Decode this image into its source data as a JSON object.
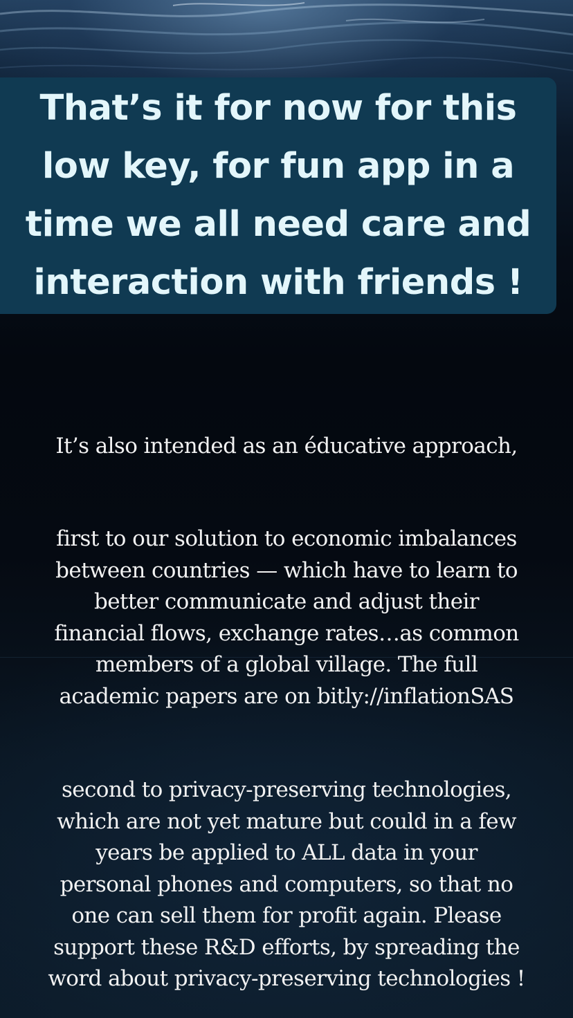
{
  "story": {
    "caption_lines": [
      "That’s it for now for this",
      "low key, for fun app in a",
      "time we all need care and",
      "interaction with friends !"
    ],
    "paragraph1_lines": [
      "It’s also intended as an éducative approach,"
    ],
    "paragraph2_lines": [
      "first to our solution to economic imbalances",
      "between countries — which have to learn to",
      "better communicate and adjust their",
      "financial flows, exchange rates…as common",
      "members of a global village. The full",
      "academic papers are on bitly://inflationSAS"
    ],
    "paragraph3_lines": [
      "second to privacy-preserving technologies,",
      "which are not yet mature but could in a few",
      "years be applied to ALL data in your",
      "personal phones and computers, so that no",
      "one can sell them for profit again. Please",
      "support these R&D efforts, by spreading the",
      "word about privacy-preserving technologies !"
    ]
  },
  "colors": {
    "caption_background": "#103a52",
    "caption_text": "#e3f6fb",
    "body_text": "#f2f2f2",
    "background_dark": "#04080f"
  }
}
